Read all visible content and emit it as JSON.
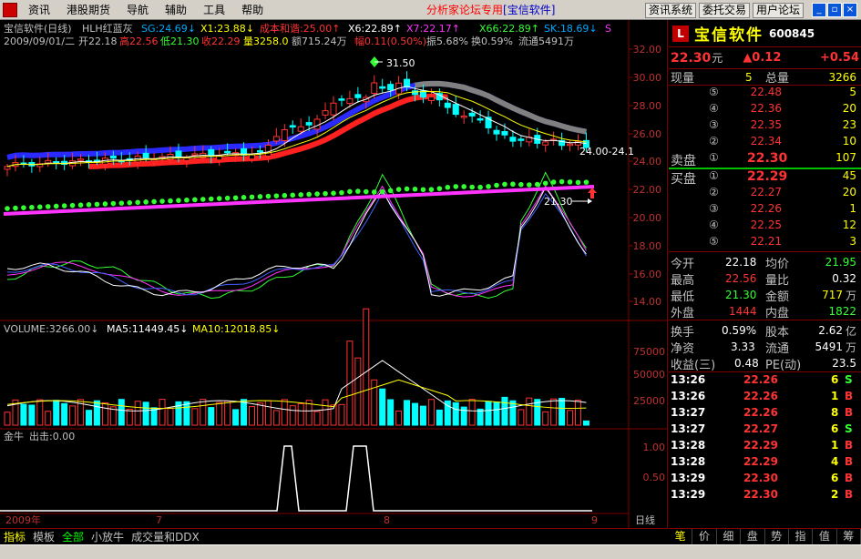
{
  "menu": {
    "items": [
      "资讯",
      "港股期货",
      "导航",
      "辅助",
      "工具",
      "帮助"
    ],
    "center_text": "分析家论坛专用",
    "center_bracket": "[宝信软件]",
    "buttons": [
      "资讯系统",
      "委托交易",
      "用户论坛"
    ]
  },
  "chart": {
    "header_line1": [
      "宝信软件(日线)",
      "HLH红蓝灰",
      "SG:24.69↓",
      "X1:23.88↓",
      "成本和谐:25.00↑",
      "X6:22.89↑",
      "X7:22.17↑",
      "X66:22.89↑",
      "SK:18.69↓",
      "S"
    ],
    "header_line2": [
      "2009/09/01/二",
      "开22.18",
      "高22.56",
      "低21.30",
      "收22.29",
      "量3258.0",
      "额715.24万",
      "幅0.11(0.50%)",
      "振5.68%",
      "换0.59%",
      "流通5491万"
    ],
    "price_axis": [
      "32.00",
      "30.00",
      "28.00",
      "26.00",
      "24.00",
      "22.00",
      "20.00",
      "18.00",
      "16.00",
      "14.00"
    ],
    "annotation_high": "31.50",
    "annotation_low": "21.30",
    "annotation_right": "24.00-24.1",
    "volume_header": [
      "VOLUME:3266.00↓",
      "MA5:11449.45↓",
      "MA10:12018.85↓"
    ],
    "volume_axis": [
      "75000",
      "50000",
      "25000"
    ],
    "indicator_header": [
      "金牛",
      "出击:0.00"
    ],
    "indicator_axis": [
      "1.00",
      "0.50"
    ],
    "date_labels": [
      "2009年",
      "7",
      "8",
      "9"
    ],
    "period": "日线"
  },
  "tabs": [
    "指标",
    "模板",
    "全部",
    "小放牛",
    "成交量和DDX"
  ],
  "stock": {
    "name": "宝信软件",
    "code": "600845",
    "logo": "L",
    "price": "22.30",
    "unit": "元",
    "change": "▲0.12",
    "change_pct": "+0.54",
    "xianliang_label": "现量",
    "xianliang": "5",
    "zongliang_label": "总量",
    "zongliang": "3266"
  },
  "orderbook": {
    "sell_label": "卖盘",
    "buy_label": "买盘",
    "sell": [
      {
        "lv": "⑤",
        "price": "22.48",
        "vol": "5"
      },
      {
        "lv": "④",
        "price": "22.36",
        "vol": "20"
      },
      {
        "lv": "③",
        "price": "22.35",
        "vol": "23"
      },
      {
        "lv": "②",
        "price": "22.34",
        "vol": "10"
      },
      {
        "lv": "①",
        "price": "22.30",
        "vol": "107"
      }
    ],
    "buy": [
      {
        "lv": "①",
        "price": "22.29",
        "vol": "45"
      },
      {
        "lv": "②",
        "price": "22.27",
        "vol": "20"
      },
      {
        "lv": "③",
        "price": "22.26",
        "vol": "1"
      },
      {
        "lv": "④",
        "price": "22.25",
        "vol": "12"
      },
      {
        "lv": "⑤",
        "price": "22.21",
        "vol": "3"
      }
    ]
  },
  "stats": {
    "kaipan_l": "今开",
    "kaipan": "22.18",
    "junjia_l": "均价",
    "junjia": "21.95",
    "zuigao_l": "最高",
    "zuigao": "22.56",
    "liangbi_l": "量比",
    "liangbi": "0.32",
    "zuidi_l": "最低",
    "zuidi": "21.30",
    "jine_l": "金额",
    "jine": "717",
    "jine_u": "万",
    "waipan_l": "外盘",
    "waipan": "1444",
    "neipan_l": "内盘",
    "neipan": "1822",
    "huanshou_l": "换手",
    "huanshou": "0.59%",
    "guben_l": "股本",
    "guben": "2.62",
    "guben_u": "亿",
    "jingzi_l": "净资",
    "jingzi": "3.33",
    "liutong_l": "流通",
    "liutong": "5491",
    "liutong_u": "万",
    "shouyi_l": "收益(三)",
    "shouyi": "0.48",
    "pe_l": "PE(动)",
    "pe": "23.5"
  },
  "ticks": [
    {
      "t": "13:26",
      "p": "22.26",
      "v": "6",
      "s": "S"
    },
    {
      "t": "13:26",
      "p": "22.26",
      "v": "1",
      "s": "B"
    },
    {
      "t": "13:27",
      "p": "22.26",
      "v": "8",
      "s": "B"
    },
    {
      "t": "13:27",
      "p": "22.27",
      "v": "6",
      "s": "S"
    },
    {
      "t": "13:28",
      "p": "22.29",
      "v": "1",
      "s": "B"
    },
    {
      "t": "13:28",
      "p": "22.29",
      "v": "4",
      "s": "B"
    },
    {
      "t": "13:29",
      "p": "22.30",
      "v": "6",
      "s": "B"
    },
    {
      "t": "13:29",
      "p": "22.30",
      "v": "2",
      "s": "B"
    }
  ],
  "right_tabs": [
    "笔",
    "价",
    "细",
    "盘",
    "势",
    "指",
    "值",
    "筹"
  ],
  "colors": {
    "up": "#ff3333",
    "down": "#00ffff",
    "blue_band": "#2a2aff",
    "red_band": "#ff2020",
    "magenta": "#ff33ff",
    "green_dots": "#33ff33",
    "yellow": "#ffff00"
  }
}
